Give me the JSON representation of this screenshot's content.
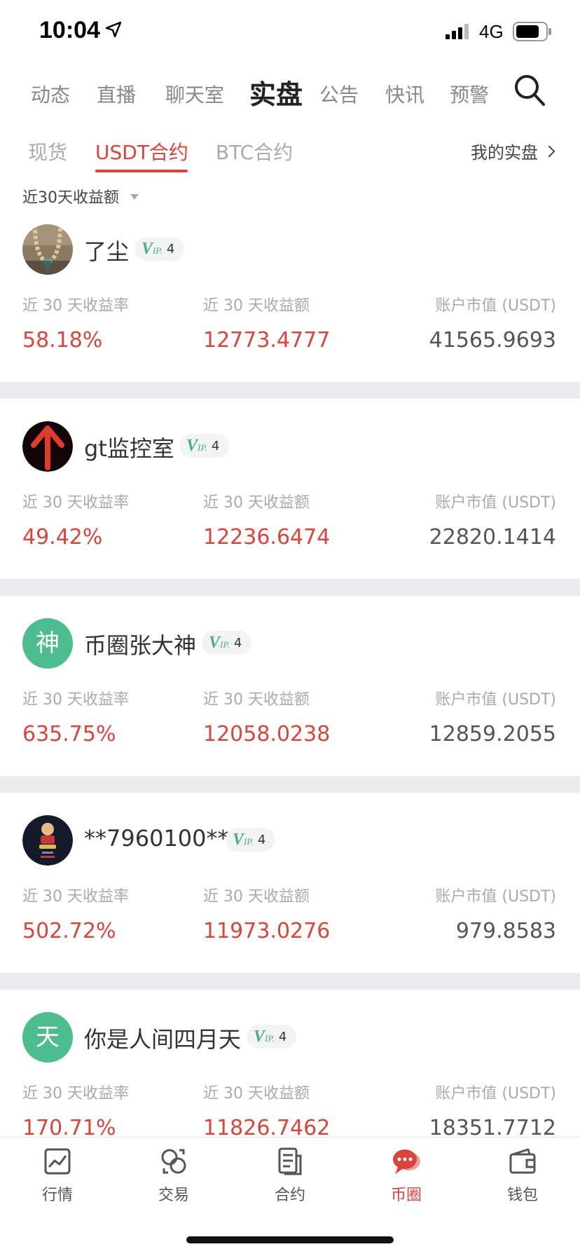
{
  "status": {
    "time": "10:04",
    "network": "4G"
  },
  "top_tabs": [
    {
      "label": "动态"
    },
    {
      "label": "直播"
    },
    {
      "label": "聊天室"
    },
    {
      "label": "实盘"
    },
    {
      "label": "公告"
    },
    {
      "label": "快讯"
    },
    {
      "label": "预警"
    }
  ],
  "sub_tabs": [
    {
      "label": "现货"
    },
    {
      "label": "USDT合约"
    },
    {
      "label": "BTC合约"
    }
  ],
  "my_link": "我的实盘",
  "sort_label": "近30天收益额",
  "stat_labels": {
    "rate": "近 30 天收益率",
    "profit": "近 30 天收益额",
    "value": "账户市值 (USDT)"
  },
  "traders": [
    {
      "name": "了尘",
      "vip_level": "4",
      "rate": "58.18%",
      "profit": "12773.4777",
      "value": "41565.9693",
      "avatar_text": "",
      "avatar_icon": "beads-photo-avatar"
    },
    {
      "name": "gt监控室",
      "vip_level": "4",
      "rate": "49.42%",
      "profit": "12236.6474",
      "value": "22820.1414",
      "avatar_text": "",
      "avatar_icon": "red-up-arrow-avatar"
    },
    {
      "name": "币圈张大神",
      "vip_level": "4",
      "rate": "635.75%",
      "profit": "12058.0238",
      "value": "12859.2055",
      "avatar_text": "神",
      "avatar_icon": ""
    },
    {
      "name": "**7960100**",
      "vip_level": "4",
      "rate": "502.72%",
      "profit": "11973.0276",
      "value": "979.8583",
      "avatar_text": "",
      "avatar_icon": "cartoon-figure-avatar"
    },
    {
      "name": "你是人间四月天",
      "vip_level": "4",
      "rate": "170.71%",
      "profit": "11826.7462",
      "value": "18351.7712",
      "avatar_text": "天",
      "avatar_icon": ""
    }
  ],
  "bottom_tabs": [
    {
      "label": "行情",
      "icon": "chart-icon"
    },
    {
      "label": "交易",
      "icon": "exchange-icon"
    },
    {
      "label": "合约",
      "icon": "document-icon"
    },
    {
      "label": "币圈",
      "icon": "chat-bubbles-icon"
    },
    {
      "label": "钱包",
      "icon": "wallet-icon"
    }
  ],
  "colors": {
    "accent": "#d8453d",
    "vip_green": "#4dae86",
    "avatar_green": "#4dbd8e",
    "divider": "#ececee"
  }
}
